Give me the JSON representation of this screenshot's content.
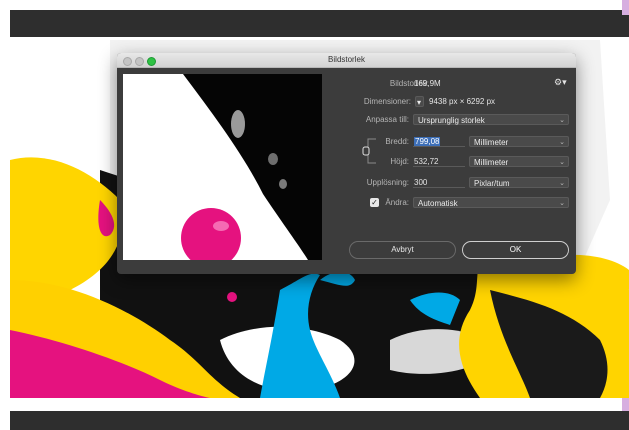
{
  "dialog": {
    "title": "Bildstorlek",
    "image_size_label": "Bildstorlek:",
    "image_size_value": "169,9M",
    "dimensions_label": "Dimensioner:",
    "dimensions_value": "9438 px  ×  6292 px",
    "fit_label": "Anpassa till:",
    "fit_value": "Ursprunglig storlek",
    "width_label": "Bredd:",
    "width_value": "799,08",
    "width_unit": "Millimeter",
    "height_label": "Höjd:",
    "height_value": "532,72",
    "height_unit": "Millimeter",
    "resolution_label": "Upplösning:",
    "resolution_value": "300",
    "resolution_unit": "Pixlar/tum",
    "resample_label": "Ändra:",
    "resample_checked": "✓",
    "resample_value": "Automatisk",
    "cancel_label": "Avbryt",
    "ok_label": "OK"
  }
}
